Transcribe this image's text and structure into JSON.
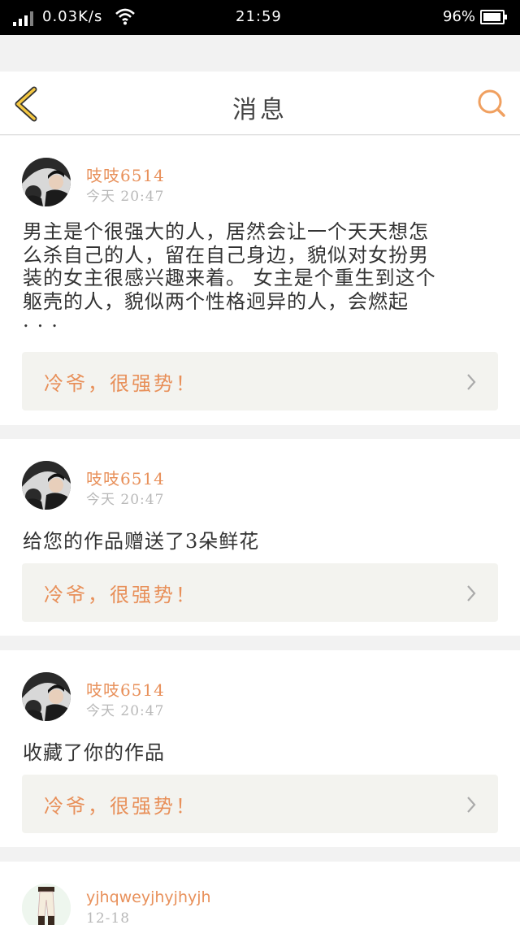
{
  "status_bar": {
    "network_speed": "0.03K/s",
    "time": "21:59",
    "battery_percent": "96%",
    "battery_level": 0.96
  },
  "header": {
    "title": "消息"
  },
  "messages": [
    {
      "username": "吱吱6514",
      "time": "今天 20:47",
      "content_lines": [
        "男主是个很强大的人，居然会让一个天天想怎",
        "么杀自己的人，留在自己身边，貌似对女扮男",
        "装的女主很感兴趣来着。 女主是个重生到这个",
        "躯壳的人，貌似两个性格迥异的人，会燃起",
        "..."
      ],
      "work_title": "冷爷，很强势！"
    },
    {
      "username": "吱吱6514",
      "time": "今天 20:47",
      "content": "给您的作品赠送了3朵鲜花",
      "work_title": "冷爷，很强势！"
    },
    {
      "username": "吱吱6514",
      "time": "今天 20:47",
      "content": "收藏了你的作品",
      "work_title": "冷爷，很强势！"
    },
    {
      "username": "yjhqweyjhyjhyjh",
      "time": "12-18"
    }
  ],
  "colors": {
    "accent": "#e8905a",
    "back_icon": "#f5c842",
    "search_icon": "#f0a060"
  }
}
